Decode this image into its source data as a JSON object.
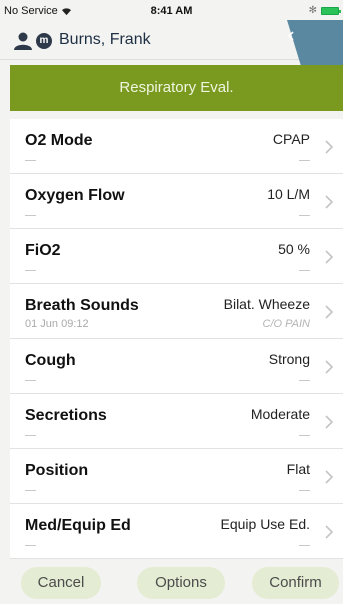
{
  "status_bar": {
    "carrier": "No Service",
    "time": "8:41 AM",
    "wifi_icon": "wifi-icon",
    "bluetooth_icon": "bluetooth-icon",
    "battery_icon": "battery-icon",
    "battery_color": "#2bc25a",
    "bluetooth_glyph": "✻"
  },
  "patient": {
    "name": "Burns, Frank",
    "badge": "m",
    "person_icon": "person-icon"
  },
  "title": "Respiratory Eval.",
  "colors": {
    "accent": "#7a9a1f",
    "title_text": "#f0f5e0",
    "corner_tab": "#5a88a0",
    "button_bg": "#e4ecd3"
  },
  "rows": [
    {
      "label": "O2 Mode",
      "value": "CPAP",
      "sub_left": "",
      "sub_right": ""
    },
    {
      "label": "Oxygen Flow",
      "value": "10 L/M",
      "sub_left": "",
      "sub_right": ""
    },
    {
      "label": "FiO2",
      "value": "50 %",
      "sub_left": "",
      "sub_right": ""
    },
    {
      "label": "Breath Sounds",
      "value": "Bilat. Wheeze",
      "sub_left": "01 Jun 09:12",
      "sub_right": "C/O PAIN"
    },
    {
      "label": "Cough",
      "value": "Strong",
      "sub_left": "",
      "sub_right": ""
    },
    {
      "label": "Secretions",
      "value": "Moderate",
      "sub_left": "",
      "sub_right": ""
    },
    {
      "label": "Position",
      "value": "Flat",
      "sub_left": "",
      "sub_right": ""
    },
    {
      "label": "Med/Equip Ed",
      "value": "Equip Use Ed.",
      "sub_left": "",
      "sub_right": ""
    }
  ],
  "footer": {
    "cancel": "Cancel",
    "options": "Options",
    "confirm": "Confirm"
  }
}
